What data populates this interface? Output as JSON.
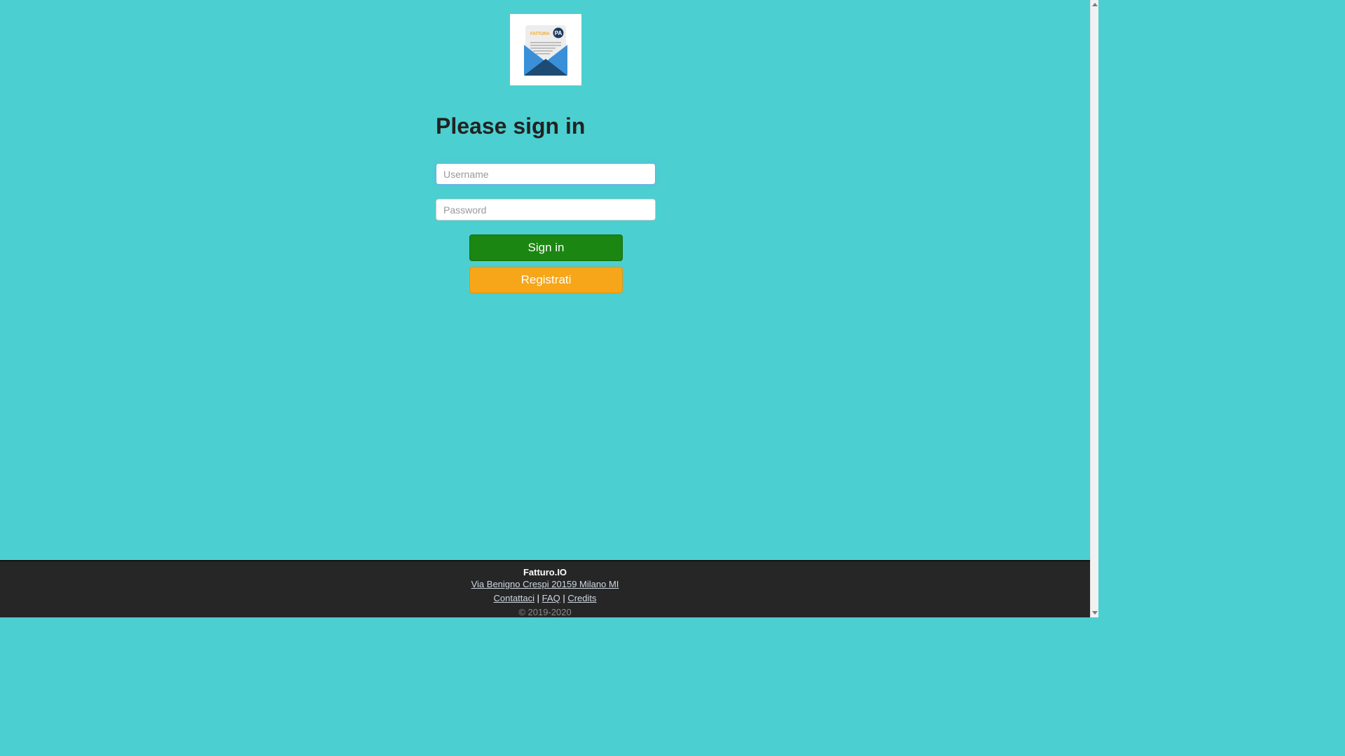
{
  "logo": {
    "text_left": "FATTURA",
    "text_badge": "PA",
    "colors": {
      "envelope_light": "#3a8fd9",
      "envelope_dark": "#1e4b73",
      "badge": "#1e3a5c",
      "accent": "#f6a618"
    }
  },
  "login": {
    "title": "Please sign in",
    "username_placeholder": "Username",
    "password_placeholder": "Password",
    "signin_label": "Sign in",
    "register_label": "Registrati"
  },
  "footer": {
    "brand": "Fatturo.IO",
    "address": "Via Benigno Crespi 20159 Milano MI",
    "links": [
      "Contattaci",
      "FAQ",
      "Credits"
    ],
    "separator": "|",
    "copyright": "© 2019-2020"
  },
  "colors": {
    "background": "#4ccfd0",
    "signin": "#1b8612",
    "register": "#f6a618",
    "footer": "#262626"
  }
}
